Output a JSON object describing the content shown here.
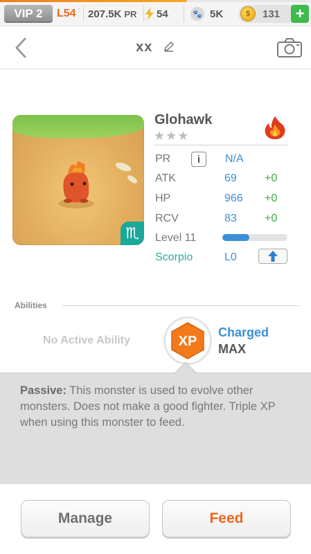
{
  "topbar": {
    "vip": "VIP 2",
    "level": "L54",
    "pr_value": "207.5K",
    "pr_unit": "PR",
    "energy": "54",
    "paw_value": "5K",
    "coins": "131",
    "add_label": "+"
  },
  "header": {
    "title": "xx"
  },
  "monster": {
    "name": "Glohawk",
    "stars": "★★★",
    "stats": {
      "pr_label": "PR",
      "pr_info": "i",
      "pr_value": "N/A",
      "atk_label": "ATK",
      "atk_value": "69",
      "atk_bonus": "+0",
      "hp_label": "HP",
      "hp_value": "966",
      "hp_bonus": "+0",
      "rcv_label": "RCV",
      "rcv_value": "83",
      "rcv_bonus": "+0",
      "level_label": "Level 11",
      "level_progress": 0.41,
      "sign_label": "Scorpio",
      "sign_level": "L0"
    },
    "zodiac_symbol": "♏",
    "element_icon": "fire-icon"
  },
  "abilities": {
    "section_label": "Abilities",
    "no_active": "No Active Ability",
    "badge_text": "XP",
    "charged_label": "Charged",
    "charged_value": "MAX",
    "passive_label": "Passive:",
    "passive_text": " This monster is used to evolve other monsters. Does not make a good fighter. Triple XP when using this monster to feed."
  },
  "actions": {
    "manage": "Manage",
    "feed": "Feed"
  },
  "colors": {
    "accent_orange": "#f0661c",
    "stat_blue": "#3b8fd6",
    "bonus_green": "#3cb043",
    "zodiac_teal": "#1aa898"
  }
}
